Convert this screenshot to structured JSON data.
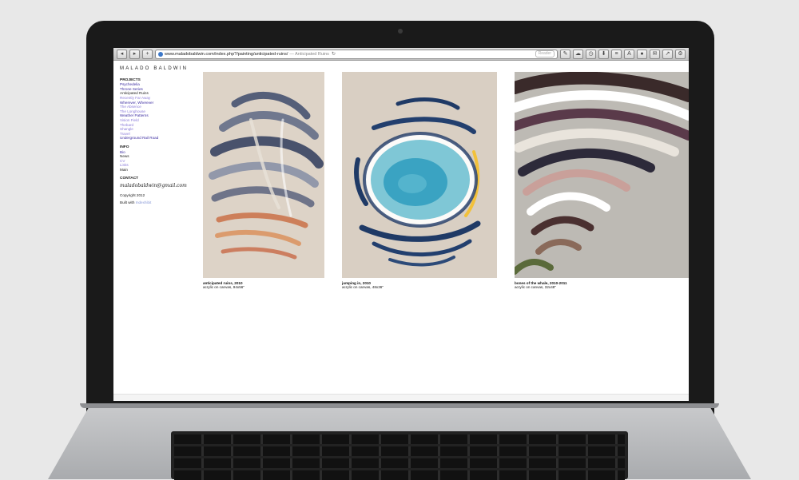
{
  "browser": {
    "url": "www.maladobaldwin.com/index.php?/painting/anticipated-ruins/",
    "page_title": "— Anticipated Ruins",
    "reader_label": "Reader"
  },
  "site": {
    "title": "MALADO BALDWIN",
    "projects_heading": "PROJECTS",
    "projects": [
      "Psychedelia",
      "Throne Series",
      "Anticipated Ruins",
      "Recently Far Away",
      "Wherever, Wherever",
      "The Absence",
      "The Longhouse",
      "Weather Patterns",
      "Vision Field",
      "Thebard",
      "Shangle",
      "Travel",
      "Underground Rail Road"
    ],
    "info_heading": "INFO",
    "info_links": [
      "Bio",
      "News",
      "CV",
      "Links",
      "Main"
    ],
    "contact_heading": "CONTACT",
    "email": "maladobaldwin@gmail.com",
    "copyright": "Copyright 2012",
    "built_with_label": "Built with",
    "built_with_link": "Indexhibit"
  },
  "works": [
    {
      "title": "anticipated ruins, 2010",
      "medium": "acrylic on canvas, 94x56\""
    },
    {
      "title": "jumping in, 2010",
      "medium": "acrylic on canvas, 48x36\""
    },
    {
      "title": "bones of the whale, 2010-2011",
      "medium": "acrylic on canvas, 32x48\""
    }
  ],
  "colors": {
    "link": "#3a2aa0",
    "visited_link": "#8a7ad8",
    "canvas_bg": "#d8cfc4"
  }
}
